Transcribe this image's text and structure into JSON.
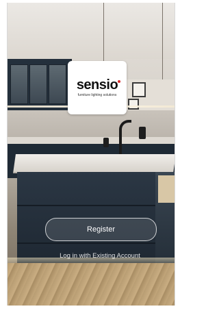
{
  "brand": {
    "logo_text": "sensio",
    "tagline": "furniture lighting solutions",
    "accent_color": "#d62a2a"
  },
  "actions": {
    "register_label": "Register",
    "login_label": "Log in with Existing Account"
  },
  "background": {
    "description_icon": "kitchen-background-image"
  }
}
